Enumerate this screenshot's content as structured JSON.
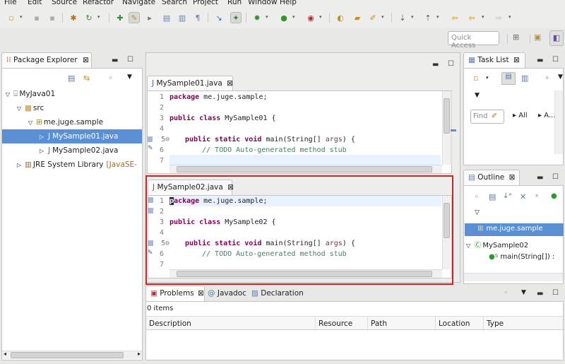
{
  "menu": [
    "File",
    "Edit",
    "Source",
    "Refactor",
    "Navigate",
    "Search",
    "Project",
    "Run",
    "Window",
    "Help"
  ],
  "toolbar": {
    "quick_access_placeholder": "Quick Access"
  },
  "package_explorer": {
    "title": "Package Explorer",
    "tree": [
      {
        "label": "MyJava01",
        "expanded": true
      },
      {
        "label": "src",
        "expanded": true
      },
      {
        "label": "me.juge.sample",
        "expanded": true
      },
      {
        "label": "MySample01.java",
        "expanded": false,
        "selected": true
      },
      {
        "label": "MySample02.java",
        "expanded": false
      },
      {
        "label": "JRE System Library",
        "decoration": "[JavaSE-"
      }
    ]
  },
  "editor1": {
    "tab": "MySample01.java",
    "line_numbers": [
      "1",
      "2",
      "3",
      "4",
      "5⊖",
      "6",
      "7"
    ],
    "lines": {
      "l1_kw": "package",
      "l1_rest": " me.juge.sample;",
      "l3_kw": "public class",
      "l3_rest": " MySample01 {",
      "l5_kw": "public static void",
      "l5_rest": " main(String[] ",
      "l5_args": "args",
      "l5_end": ") {",
      "l6": "// TODO Auto-generated method stub"
    }
  },
  "editor2": {
    "tab": "MySample02.java",
    "line_numbers": [
      "1",
      "2",
      "3",
      "4",
      "5⊖",
      "6",
      "7"
    ],
    "lines": {
      "l1_kw_first": "p",
      "l1_kw": "ackage",
      "l1_rest": " me.juge.sample;",
      "l3_kw": "public class",
      "l3_rest": " MySample02 {",
      "l5_kw": "public static void",
      "l5_rest": " main(String[] ",
      "l5_args": "args",
      "l5_end": ") {",
      "l6": "// TODO Auto-generated method stub"
    }
  },
  "task_list": {
    "title": "Task List",
    "find_placeholder": "Find",
    "filter_all": "▸ All",
    "filter_a": "▸ A..."
  },
  "outline": {
    "title": "Outline",
    "items": [
      {
        "label": "me.juge.sample"
      },
      {
        "label": "MySample02"
      },
      {
        "label": "main(String[]) :"
      }
    ]
  },
  "bottom": {
    "tabs": [
      "Problems",
      "Javadoc",
      "Declaration"
    ],
    "item_count": "0 items",
    "columns": [
      "Description",
      "Resource",
      "Path",
      "Location",
      "Type"
    ]
  },
  "colors": {
    "highlight_border": "#d42020",
    "selection": "#5a8fd4",
    "keyword": "#7f0055",
    "comment": "#3f7f5f"
  }
}
